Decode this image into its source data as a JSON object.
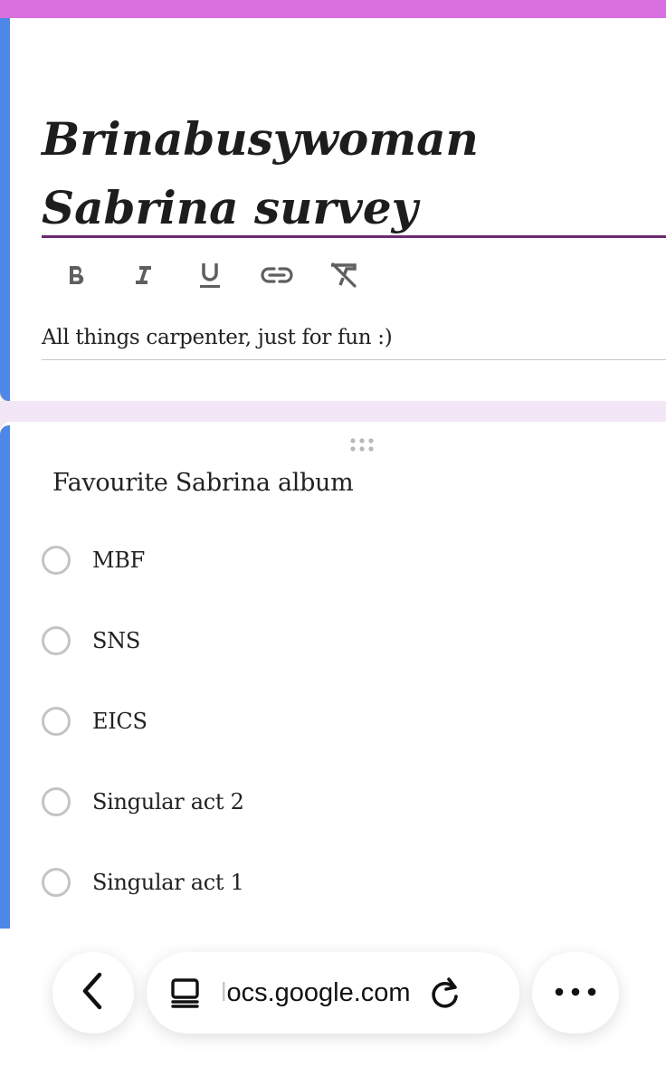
{
  "form": {
    "title": "Brinabusywoman Sabrina survey",
    "description": "All things carpenter, just for fun :)",
    "toolbar": [
      "bold-icon",
      "italic-icon",
      "underline-icon",
      "link-icon",
      "clear-formatting-icon"
    ]
  },
  "question": {
    "title": "Favourite Sabrina album",
    "options": [
      "MBF",
      "SNS",
      "EICS",
      "Singular act 2",
      "Singular act 1"
    ]
  },
  "browser": {
    "url_faded": "l",
    "url_main": "ocs.google.com",
    "icons": [
      "back-icon",
      "reader-mode-icon",
      "reload-icon",
      "more-icon"
    ]
  },
  "colors": {
    "top_band": "#d770de",
    "accent": "#4d87e8",
    "title_underline": "#6b2a6f",
    "gap_band": "#f3e6f6"
  }
}
